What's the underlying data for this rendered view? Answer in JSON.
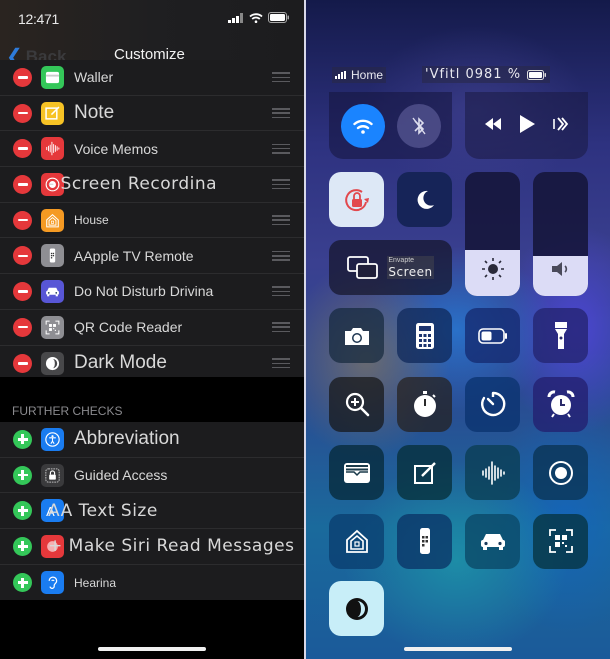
{
  "left": {
    "status_bar": {
      "time": "12:471",
      "icons": [
        "signal-icon",
        "wifi-icon",
        "battery-icon"
      ]
    },
    "nav": {
      "back_label": "Back",
      "title": "Customize"
    },
    "included_controls": [
      {
        "label": "Waller",
        "icon": "wallet-icon",
        "color": "#34c759",
        "style": "normal"
      },
      {
        "label": "Note",
        "icon": "note-icon",
        "color": "#f7c325",
        "style": "big"
      },
      {
        "label": "Voice Memos",
        "icon": "voice-memos-icon",
        "color": "#e5383b",
        "style": "normal"
      },
      {
        "label": "- Screen Recordina",
        "icon": "screen-recording-icon",
        "color": "#e5383b",
        "style": "wide"
      },
      {
        "label": "House",
        "icon": "home-icon",
        "color": "#f59a23",
        "style": "small"
      },
      {
        "label": "AApple TV Remote",
        "icon": "apple-tv-remote-icon",
        "color": "#8e8e93",
        "style": "normal"
      },
      {
        "label": "Do Not Disturb Drivina",
        "icon": "car-icon",
        "color": "#5856d6",
        "style": "normal"
      },
      {
        "label": "QR Code Reader",
        "icon": "qr-code-icon",
        "color": "#8e8e93",
        "style": "normal"
      },
      {
        "label": "Dark Mode",
        "icon": "dark-mode-icon",
        "color": "#48484a",
        "style": "big"
      }
    ],
    "section_title": "FURTHER CHECKS",
    "more_controls": [
      {
        "label": "Abbreviation",
        "icon": "accessibility-icon",
        "color": "#1a7cf0",
        "style": "big"
      },
      {
        "label": "Guided Access",
        "icon": "guided-access-icon",
        "color": "#3a3a3c",
        "style": "normal"
      },
      {
        "label": "AA Text Size",
        "icon": "text-size-icon",
        "color": "#1a7cf0",
        "style": "wide"
      },
      {
        "label": "+ Make Siri Read Messages",
        "icon": "siri-icon",
        "color": "#e5383b",
        "style": "wide"
      },
      {
        "label": "Hearina",
        "icon": "hearing-icon",
        "color": "#1a7cf0",
        "style": "small"
      }
    ]
  },
  "right": {
    "status_bar": {
      "carrier": "Home",
      "right_text": "'Vfitl 0981 %"
    },
    "connectivity": {
      "wifi": "on",
      "bluetooth": "off"
    },
    "media": {
      "controls": [
        "rewind-icon",
        "play-icon",
        "airplay-audio-icon"
      ]
    },
    "toggles": {
      "orientation_lock": "on",
      "do_not_disturb": "off"
    },
    "screen_mirroring": {
      "small_label": "Envapte",
      "label": "Screen"
    },
    "brightness": {
      "level": 0.37
    },
    "volume": {
      "level": 0.32
    },
    "grid_controls": [
      "camera-icon",
      "calculator-icon",
      "low-power-mode-icon",
      "flashlight-icon",
      "magnifier-icon",
      "stopwatch-icon",
      "timer-icon",
      "alarm-icon",
      "wallet-icon",
      "notes-icon",
      "voice-memos-icon",
      "screen-recording-icon",
      "home-icon",
      "apple-tv-remote-icon",
      "car-icon",
      "qr-code-icon"
    ],
    "dark_mode": {
      "state": "on"
    }
  }
}
